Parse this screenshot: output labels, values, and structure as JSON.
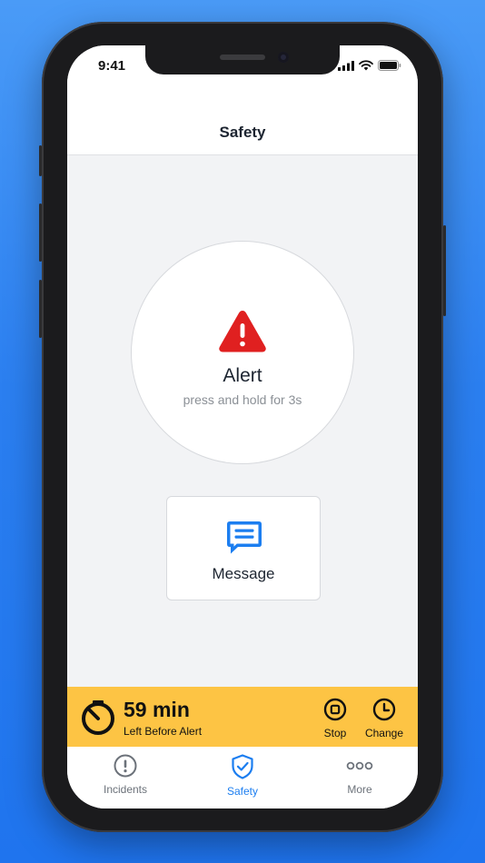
{
  "status_bar": {
    "time": "9:41"
  },
  "header": {
    "title": "Safety"
  },
  "alert": {
    "label": "Alert",
    "hint": "press and hold for 3s",
    "icon": "warning-triangle-icon",
    "icon_color": "#e02020"
  },
  "message": {
    "label": "Message",
    "icon": "chat-message-icon",
    "icon_color": "#1c7ef0"
  },
  "timer": {
    "value": "59 min",
    "caption": "Left Before Alert",
    "bar_color": "#fdc444",
    "stop_label": "Stop",
    "change_label": "Change"
  },
  "tabs": [
    {
      "label": "Incidents",
      "icon": "exclamation-circle-icon",
      "active": false
    },
    {
      "label": "Safety",
      "icon": "shield-check-icon",
      "active": true
    },
    {
      "label": "More",
      "icon": "more-dots-icon",
      "active": false
    }
  ],
  "colors": {
    "accent": "#1c7ef0",
    "background": "#f2f3f5"
  }
}
